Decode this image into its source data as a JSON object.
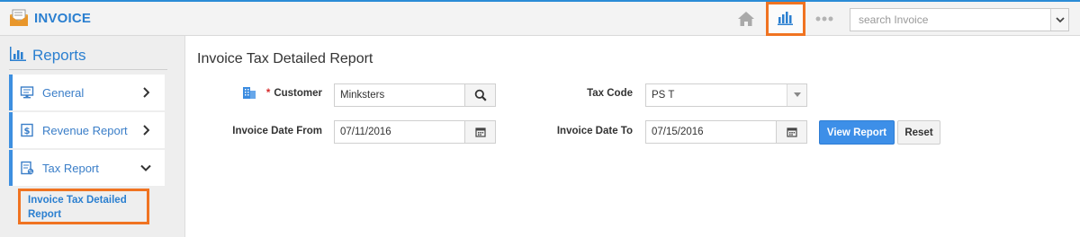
{
  "app": {
    "title": "INVOICE",
    "brand_color": "#2a7fd0",
    "accent_highlight": "#f07321"
  },
  "topbar": {
    "icons": [
      "home-icon",
      "bar-chart-icon",
      "more-dots-icon"
    ],
    "search_placeholder": "search Invoice"
  },
  "sidebar": {
    "heading": "Reports",
    "items": [
      {
        "label": "General",
        "icon": "monitor-icon",
        "expanded": false
      },
      {
        "label": "Revenue Report",
        "icon": "revenue-icon",
        "expanded": false
      },
      {
        "label": "Tax Report",
        "icon": "tax-icon",
        "expanded": true
      }
    ],
    "sub_item": {
      "label": "Invoice Tax Detailed Report"
    }
  },
  "main": {
    "title": "Invoice Tax Detailed Report",
    "form": {
      "customer_label": "Customer",
      "customer_required": "*",
      "customer_value": "Minksters",
      "tax_code_label": "Tax Code",
      "tax_code_value": "PS T",
      "date_from_label": "Invoice Date From",
      "date_from_value": "07/11/2016",
      "date_to_label": "Invoice Date To",
      "date_to_value": "07/15/2016"
    },
    "buttons": {
      "view_report": "View Report",
      "reset": "Reset"
    }
  }
}
